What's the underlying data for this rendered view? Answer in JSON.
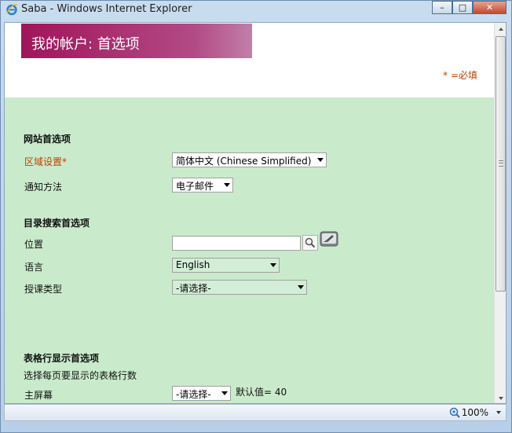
{
  "window": {
    "title": "Saba - Windows Internet Explorer",
    "minimize_glyph": "–",
    "maximize_glyph": "□",
    "close_glyph": "✕"
  },
  "page": {
    "header_title": "我的帐户: 首选项",
    "header_color": "#a0145a",
    "required_note": "* =必填",
    "required_color": "#c04000",
    "background_color": "#c9ebcb"
  },
  "site_prefs": {
    "heading": "网站首选项",
    "locale_label": "区域设置*",
    "locale_value": "简体中文 (Chinese Simplified)",
    "notify_label": "通知方法",
    "notify_value": "电子邮件"
  },
  "catalog_prefs": {
    "heading": "目录搜索首选项",
    "location_label": "位置",
    "location_value": "",
    "language_label": "语言",
    "language_value": "English",
    "delivery_label": "授课类型",
    "delivery_value": "-请选择-"
  },
  "table_prefs": {
    "heading": "表格行显示首选项",
    "subtitle": "选择每页要显示的表格行数",
    "home_label": "主屏幕",
    "home_value": "-请选择-",
    "home_default": "默认值= 40"
  },
  "statusbar": {
    "zoom": "100%"
  },
  "icons": {
    "browser": "ie-icon",
    "search": "search-icon",
    "clear": "eraser-icon",
    "zoom": "zoom-icon"
  }
}
